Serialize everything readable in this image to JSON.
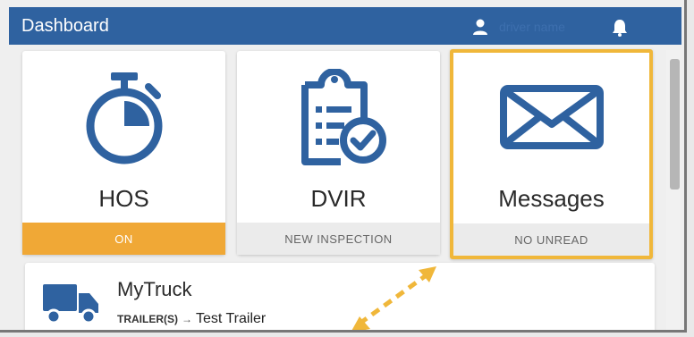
{
  "header": {
    "title": "Dashboard",
    "user_name": "driver name",
    "user_icon": "user-icon",
    "notification_icon": "bell-icon"
  },
  "tiles": [
    {
      "label": "HOS",
      "status": "ON",
      "icon": "stopwatch-icon",
      "status_color": "#f0a836"
    },
    {
      "label": "DVIR",
      "status": "NEW INSPECTION",
      "icon": "clipboard-check-icon"
    },
    {
      "label": "Messages",
      "status": "NO UNREAD",
      "icon": "envelope-icon",
      "highlight_color": "#f0b73a"
    }
  ],
  "truck": {
    "name": "MyTruck",
    "trailer_label": "TRAILER(S)",
    "arrow": "→",
    "trailer_value": "Test Trailer",
    "icon": "truck-icon"
  },
  "colors": {
    "header_bg": "#2f62a0",
    "icon_blue": "#2f62a0",
    "accent_orange": "#f0a836",
    "annotation_arrow": "#f0b73a"
  }
}
